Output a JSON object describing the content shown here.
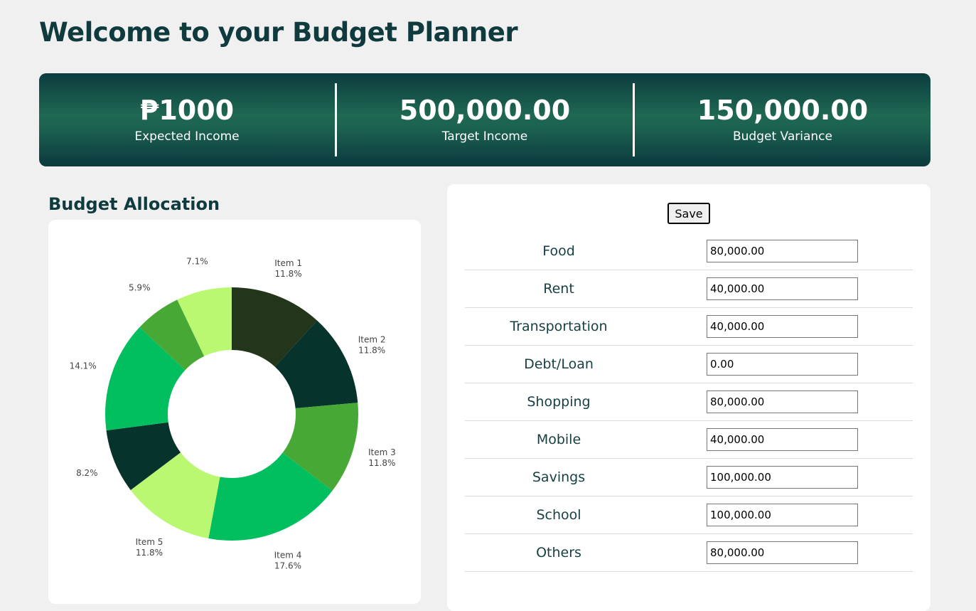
{
  "header": {
    "title": "Welcome to your Budget Planner"
  },
  "summary": {
    "stats": [
      {
        "value": "₱1000",
        "label": "Expected Income"
      },
      {
        "value": "500,000.00",
        "label": "Target Income"
      },
      {
        "value": "150,000.00",
        "label": "Budget Variance"
      }
    ]
  },
  "allocation": {
    "title": "Budget Allocation"
  },
  "form": {
    "save_label": "Save",
    "rows": [
      {
        "label": "Food",
        "value": "80,000.00"
      },
      {
        "label": "Rent",
        "value": "40,000.00"
      },
      {
        "label": "Transportation",
        "value": "40,000.00"
      },
      {
        "label": "Debt/Loan",
        "value": "0.00"
      },
      {
        "label": "Shopping",
        "value": "80,000.00"
      },
      {
        "label": "Mobile",
        "value": "40,000.00"
      },
      {
        "label": "Savings",
        "value": "100,000.00"
      },
      {
        "label": "School",
        "value": "100,000.00"
      },
      {
        "label": "Others",
        "value": "80,000.00"
      }
    ]
  },
  "chart_data": {
    "type": "pie",
    "donut": true,
    "slices": [
      {
        "name": "Item 1",
        "value": 11.8,
        "label": "11.8%",
        "color": "#23361c"
      },
      {
        "name": "Item 2",
        "value": 11.8,
        "label": "11.8%",
        "color": "#06332c"
      },
      {
        "name": "Item 3",
        "value": 11.8,
        "label": "11.8%",
        "color": "#48a836"
      },
      {
        "name": "Item 4",
        "value": 17.6,
        "label": "17.6%",
        "color": "#01bf5f"
      },
      {
        "name": "Item 5",
        "value": 11.8,
        "label": "11.8%",
        "color": "#baf872"
      },
      {
        "name": "",
        "value": 8.2,
        "label": "8.2%",
        "color": "#06332c"
      },
      {
        "name": "",
        "value": 14.1,
        "label": "14.1%",
        "color": "#01bf5f"
      },
      {
        "name": "",
        "value": 5.9,
        "label": "5.9%",
        "color": "#48a836"
      },
      {
        "name": "",
        "value": 7.1,
        "label": "7.1%",
        "color": "#baf872"
      }
    ]
  }
}
